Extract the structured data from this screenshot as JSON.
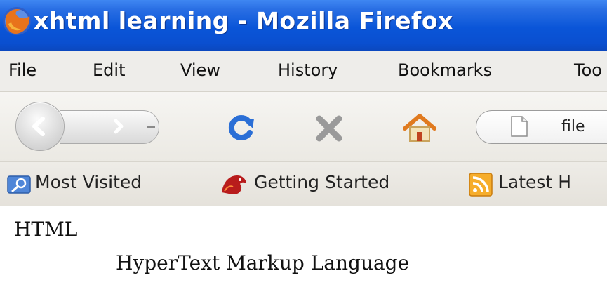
{
  "window": {
    "title": "xhtml learning - Mozilla Firefox"
  },
  "menu": {
    "items": [
      "File",
      "Edit",
      "View",
      "History",
      "Bookmarks",
      "Too"
    ]
  },
  "navigation": {
    "back_icon": "back-arrow-icon",
    "forward_icon": "forward-arrow-icon",
    "reload_icon": "reload-icon",
    "stop_icon": "stop-icon",
    "home_icon": "home-icon",
    "url_value": "file",
    "colors": {
      "reload": "#2b6fd6",
      "stop": "#9a9a9a",
      "home_roof": "#e07a1f"
    }
  },
  "bookmarks": {
    "items": [
      "Most Visited",
      "Getting Started",
      "Latest H"
    ]
  },
  "content": {
    "term": "HTML",
    "definition": "HyperText Markup Language"
  }
}
